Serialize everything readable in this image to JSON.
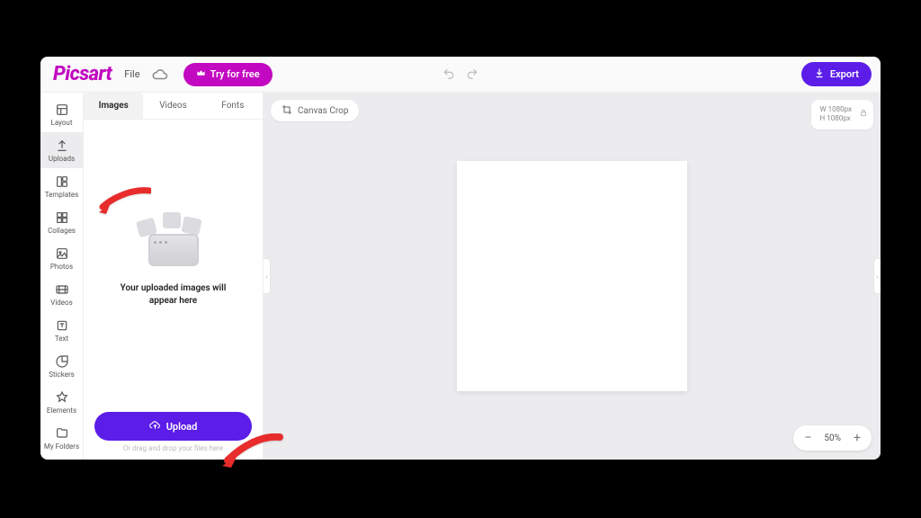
{
  "brand": {
    "name": "Picsart"
  },
  "topbar": {
    "file_label": "File",
    "try_label": "Try for free",
    "export_label": "Export"
  },
  "left_rail": {
    "items": [
      {
        "label": "Layout"
      },
      {
        "label": "Uploads"
      },
      {
        "label": "Templates"
      },
      {
        "label": "Collages"
      },
      {
        "label": "Photos"
      },
      {
        "label": "Videos"
      },
      {
        "label": "Text"
      },
      {
        "label": "Stickers"
      },
      {
        "label": "Elements"
      },
      {
        "label": "My Folders"
      }
    ]
  },
  "side_panel": {
    "tabs": [
      {
        "label": "Images"
      },
      {
        "label": "Videos"
      },
      {
        "label": "Fonts"
      }
    ],
    "placeholder_line1": "Your uploaded images will",
    "placeholder_line2": "appear here",
    "upload_label": "Upload",
    "drag_hint": "Or drag and drop your files here"
  },
  "canvas": {
    "crop_label": "Canvas Crop",
    "dims_w_label": "W",
    "dims_w_value": "1080px",
    "dims_h_label": "H",
    "dims_h_value": "1080px",
    "zoom_value": "50%"
  }
}
